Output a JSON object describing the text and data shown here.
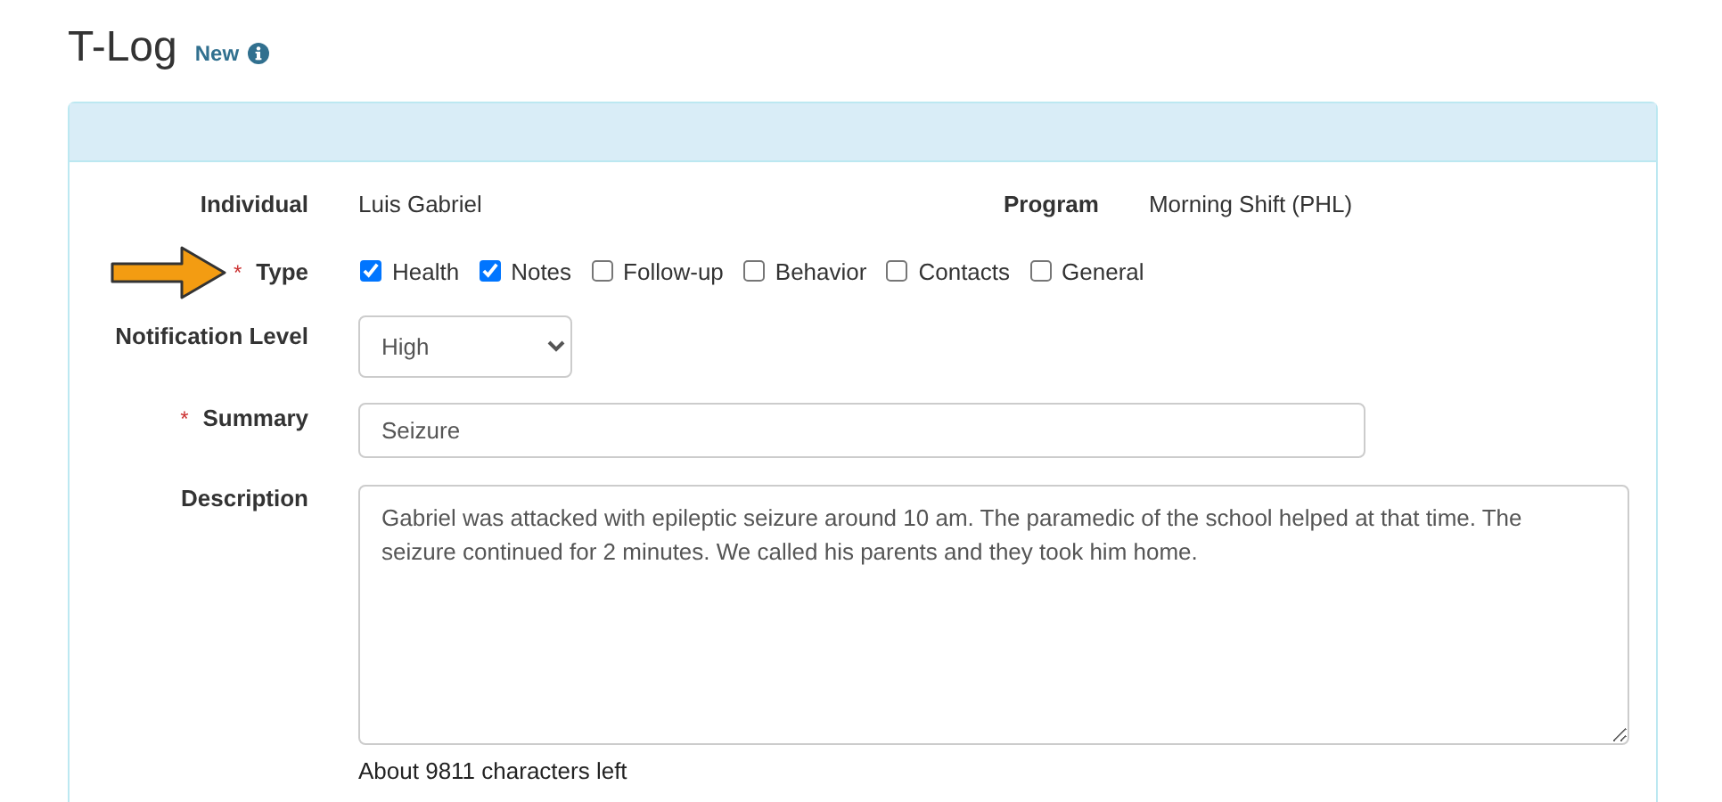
{
  "page": {
    "title": "T-Log",
    "badge": "New"
  },
  "form": {
    "individual": {
      "label": "Individual",
      "value": "Luis Gabriel"
    },
    "program": {
      "label": "Program",
      "value": "Morning Shift (PHL)"
    },
    "type": {
      "required_mark": "*",
      "label": "Type",
      "options": [
        {
          "label": "Health",
          "checked": true
        },
        {
          "label": "Notes",
          "checked": true
        },
        {
          "label": "Follow-up",
          "checked": false
        },
        {
          "label": "Behavior",
          "checked": false
        },
        {
          "label": "Contacts",
          "checked": false
        },
        {
          "label": "General",
          "checked": false
        }
      ]
    },
    "notification_level": {
      "label": "Notification Level",
      "value": "High"
    },
    "summary": {
      "required_mark": "*",
      "label": "Summary",
      "value": "Seizure"
    },
    "description": {
      "label": "Description",
      "value": "Gabriel was attacked with epileptic seizure around 10 am. The paramedic of the school helped at that time. The seizure continued for 2 minutes. We called his parents and they took him home.",
      "counter": "About 9811 characters left"
    }
  }
}
